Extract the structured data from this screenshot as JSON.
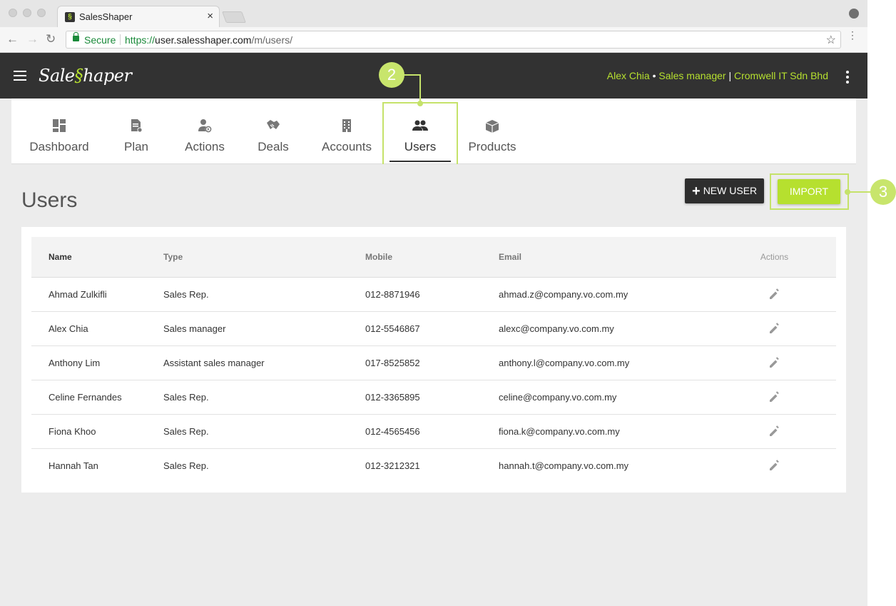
{
  "browser": {
    "tab_title": "SalesShaper",
    "tab_close": "×",
    "secure_label": "Secure",
    "url_scheme": "https://",
    "url_host": "user.salesshaper.com",
    "url_path": "/m/users/"
  },
  "app": {
    "logo_left": "Sale",
    "logo_accent": "§",
    "logo_right": "haper",
    "user_name": "Alex Chia",
    "dot": " • ",
    "user_role": "Sales manager",
    "bar": " | ",
    "company": "Cromwell IT Sdn Bhd"
  },
  "nav": {
    "tabs": [
      {
        "label": "Dashboard",
        "icon": "dashboard-icon"
      },
      {
        "label": "Plan",
        "icon": "plan-icon"
      },
      {
        "label": "Actions",
        "icon": "actions-icon"
      },
      {
        "label": "Deals",
        "icon": "deals-icon"
      },
      {
        "label": "Accounts",
        "icon": "accounts-icon"
      },
      {
        "label": "Users",
        "icon": "users-icon",
        "active": true
      },
      {
        "label": "Products",
        "icon": "products-icon"
      }
    ]
  },
  "callouts": {
    "users_step": "2",
    "import_step": "3"
  },
  "page": {
    "title": "Users",
    "new_user_label": "NEW USER",
    "import_label": "IMPORT"
  },
  "table": {
    "headers": {
      "name": "Name",
      "type": "Type",
      "mobile": "Mobile",
      "email": "Email",
      "actions": "Actions"
    },
    "rows": [
      {
        "name": "Ahmad Zulkifli",
        "type": "Sales Rep.",
        "mobile": "012-8871946",
        "email": "ahmad.z@company.vo.com.my"
      },
      {
        "name": "Alex Chia",
        "type": "Sales manager",
        "mobile": "012-5546867",
        "email": "alexc@company.vo.com.my"
      },
      {
        "name": "Anthony Lim",
        "type": "Assistant sales manager",
        "mobile": "017-8525852",
        "email": "anthony.l@company.vo.com.my"
      },
      {
        "name": "Celine Fernandes",
        "type": "Sales Rep.",
        "mobile": "012-3365895",
        "email": "celine@company.vo.com.my"
      },
      {
        "name": "Fiona Khoo",
        "type": "Sales Rep.",
        "mobile": "012-4565456",
        "email": "fiona.k@company.vo.com.my"
      },
      {
        "name": "Hannah Tan",
        "type": "Sales Rep.",
        "mobile": "012-3212321",
        "email": "hannah.t@company.vo.com.my"
      }
    ]
  },
  "colors": {
    "accent": "#b6e02f",
    "header_bg": "#323232",
    "callout": "#c8e56c"
  }
}
